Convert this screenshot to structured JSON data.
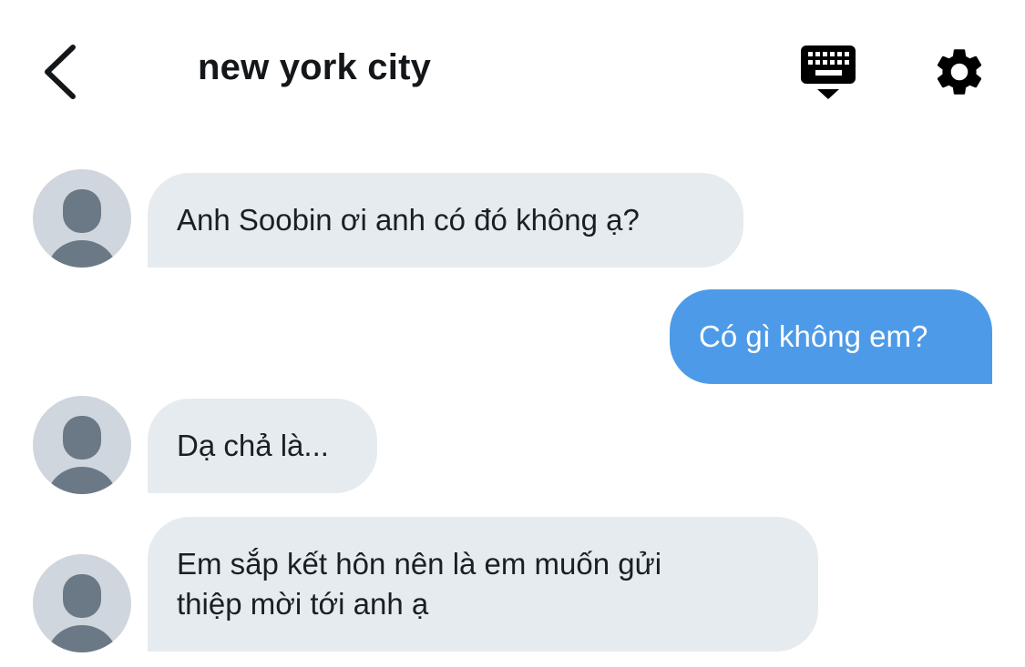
{
  "header": {
    "title": "new york city",
    "back_icon": "chevron-left-icon",
    "keyboard_icon": "keyboard-icon",
    "settings_icon": "gear-icon"
  },
  "colors": {
    "incoming_bubble": "#e6ebef",
    "outgoing_bubble": "#4d9be8",
    "avatar_bg": "#cfd6dd",
    "avatar_fg": "#6b7986"
  },
  "messages": [
    {
      "direction": "incoming",
      "lines": [
        "Anh Soobin ơi anh có đó không ạ?"
      ]
    },
    {
      "direction": "outgoing",
      "lines": [
        "Có gì không em?"
      ]
    },
    {
      "direction": "incoming",
      "lines": [
        "Dạ chả là..."
      ]
    },
    {
      "direction": "incoming",
      "lines": [
        "Em sắp kết hôn nên là em muốn gửi",
        "thiệp mời tới anh ạ"
      ]
    }
  ]
}
